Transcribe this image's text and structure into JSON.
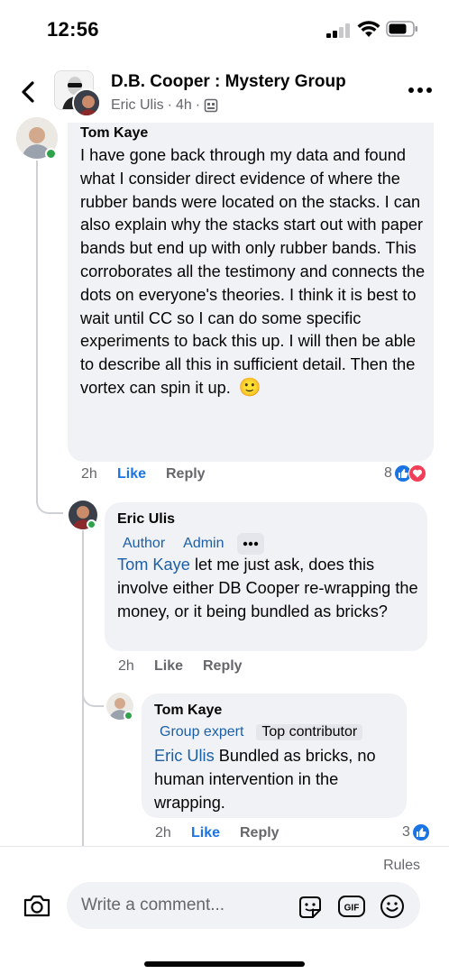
{
  "status_bar": {
    "time": "12:56"
  },
  "header": {
    "group_name": "D.B. Cooper : Mystery Group",
    "poster": "Eric Ulis",
    "time_ago": "4h",
    "separator": "·"
  },
  "comments": [
    {
      "author": "Tom Kaye",
      "text": "I have gone back through my data and found what I consider direct evidence of where the rubber bands were located on the stacks. I can also explain why the stacks start out with paper bands but end up with only rubber bands. This corroborates all the testimony and connects the dots on everyone's theories. I think it is best to wait until CC so I can do some specific experiments to back this up. I will then be able to describe all this in sufficient detail. Then the vortex can spin it up.",
      "emoji": "🙂",
      "time": "2h",
      "like_label": "Like",
      "reply_label": "Reply",
      "reaction_count": "8",
      "reactions": [
        "like",
        "love"
      ]
    },
    {
      "author": "Eric Ulis",
      "badges": [
        "Author",
        "Admin"
      ],
      "mention": "Tom Kaye",
      "text": "let me just ask, does this involve either DB Cooper re-wrapping the money, or it being bundled as bricks?",
      "time": "2h",
      "like_label": "Like",
      "reply_label": "Reply"
    },
    {
      "author": "Tom Kaye",
      "badges": [
        "Group expert",
        "Top contributor"
      ],
      "mention": "Eric Ulis",
      "text": "Bundled as bricks, no human intervention in the wrapping.",
      "time": "2h",
      "like_label": "Like",
      "reply_label": "Reply",
      "reaction_count": "3",
      "reactions": [
        "like"
      ]
    }
  ],
  "footer": {
    "rules_label": "Rules",
    "comment_placeholder": "Write a comment...",
    "icons": [
      "camera-icon",
      "sticker-icon",
      "gif-icon",
      "emoji-icon"
    ]
  },
  "colors": {
    "link_blue": "#1b74e4",
    "badge_blue": "#1b5fa7",
    "bubble_bg": "#f0f2f5",
    "online_green": "#31a24c",
    "love_red": "#f33e58"
  }
}
